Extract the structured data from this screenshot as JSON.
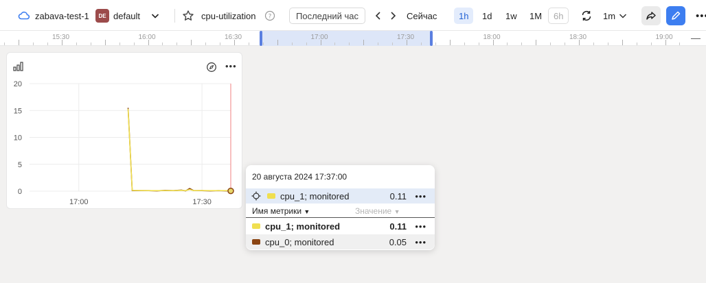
{
  "header": {
    "folder": "zabava-test-1",
    "avatar": "DE",
    "environment": "default",
    "dashboard_title": "cpu-utilization",
    "range_button": "Последний час",
    "now_label": "Сейчас",
    "zooms": [
      "1h",
      "1d",
      "1w",
      "1M",
      "6h"
    ],
    "active_zoom": "1h",
    "refresh_interval": "1m",
    "accent_color": "#3d7ef0"
  },
  "timeline": {
    "ticks": [
      "15:30",
      "16:00",
      "16:30",
      "17:00",
      "17:30",
      "18:00",
      "18:30",
      "19:00"
    ],
    "selection_start": "17:00",
    "selection_end": "17:30"
  },
  "panel": {
    "chart_data": {
      "type": "line",
      "title": "",
      "xlabel": "",
      "ylabel": "",
      "x_ticks": [
        "17:00",
        "17:30"
      ],
      "y_ticks": [
        0,
        5,
        10,
        15,
        20
      ],
      "ylim": [
        0,
        20
      ],
      "xlim_minutes": [
        "16:48",
        "17:37"
      ],
      "grid": true,
      "cursor_time": "17:37",
      "series": [
        {
          "name": "cpu_0; monitored",
          "color": "#8b4513",
          "points": [
            [
              "17:12",
              15.5
            ],
            [
              "17:13",
              0.1
            ],
            [
              "17:15",
              0.1
            ],
            [
              "17:17",
              0.1
            ],
            [
              "17:19",
              0.05
            ],
            [
              "17:21",
              0.15
            ],
            [
              "17:23",
              0.1
            ],
            [
              "17:25",
              0.2
            ],
            [
              "17:26",
              0.05
            ],
            [
              "17:27",
              0.5
            ],
            [
              "17:28",
              0.1
            ],
            [
              "17:30",
              0.1
            ],
            [
              "17:32",
              0.05
            ],
            [
              "17:34",
              0.1
            ],
            [
              "17:36",
              0.05
            ],
            [
              "17:37",
              0.05
            ]
          ]
        },
        {
          "name": "cpu_1; monitored",
          "color": "#f0df50",
          "points": [
            [
              "17:12",
              15.3
            ],
            [
              "17:13",
              0.15
            ],
            [
              "17:15",
              0.12
            ],
            [
              "17:17",
              0.1
            ],
            [
              "17:19",
              0.1
            ],
            [
              "17:21",
              0.1
            ],
            [
              "17:23",
              0.1
            ],
            [
              "17:25",
              0.15
            ],
            [
              "17:26",
              0.1
            ],
            [
              "17:27",
              0.3
            ],
            [
              "17:28",
              0.1
            ],
            [
              "17:30",
              0.12
            ],
            [
              "17:32",
              0.1
            ],
            [
              "17:34",
              0.1
            ],
            [
              "17:36",
              0.1
            ],
            [
              "17:37",
              0.11
            ]
          ]
        }
      ]
    }
  },
  "tooltip": {
    "date": "20 августа 2024 17:37:00",
    "highlighted": {
      "name": "cpu_1; monitored",
      "value": "0.11",
      "color": "#f0df50"
    },
    "header_name": "Имя метрики",
    "header_value": "Значение",
    "rows": [
      {
        "name": "cpu_1; monitored",
        "value": "0.11",
        "color": "#f0df50"
      },
      {
        "name": "cpu_0; monitored",
        "value": "0.05",
        "color": "#8b4513"
      }
    ]
  }
}
